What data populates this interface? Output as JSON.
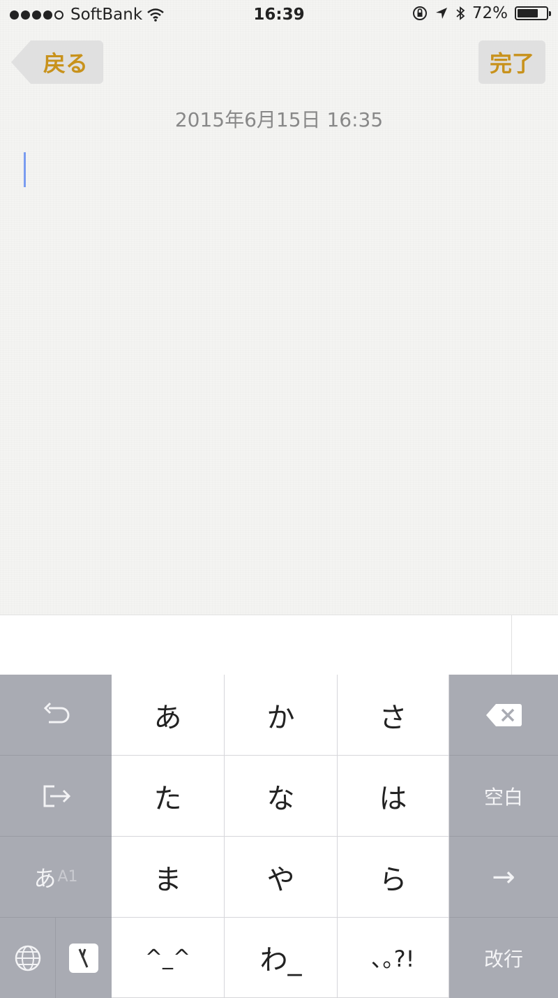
{
  "status_bar": {
    "carrier": "SoftBank",
    "time": "16:39",
    "battery": "72%",
    "battery_level": 0.72,
    "signal_bars": 4,
    "signal_total": 5
  },
  "nav": {
    "back_label": "戻る",
    "done_label": "完了"
  },
  "note": {
    "date": "2015年6月15日 16:35"
  },
  "colors": {
    "accent": "#c8921c",
    "side_key": "#a9abb3",
    "cursor": "#7a9cf0"
  },
  "keyboard": {
    "undo_icon": "undo-icon",
    "move_icon": "cursor-move-icon",
    "mode_primary": "あ",
    "mode_secondary": "A1",
    "globe_icon": "globe-icon",
    "ime_icon": "ime-logo-icon",
    "row1": [
      "あ",
      "か",
      "さ"
    ],
    "row2": [
      "た",
      "な",
      "は"
    ],
    "row3": [
      "ま",
      "や",
      "ら"
    ],
    "row4": [
      "^_^",
      "わ_",
      "､｡?!"
    ],
    "delete_icon": "delete-icon",
    "space_label": "空白",
    "arrow_label": "→",
    "return_label": "改行"
  }
}
